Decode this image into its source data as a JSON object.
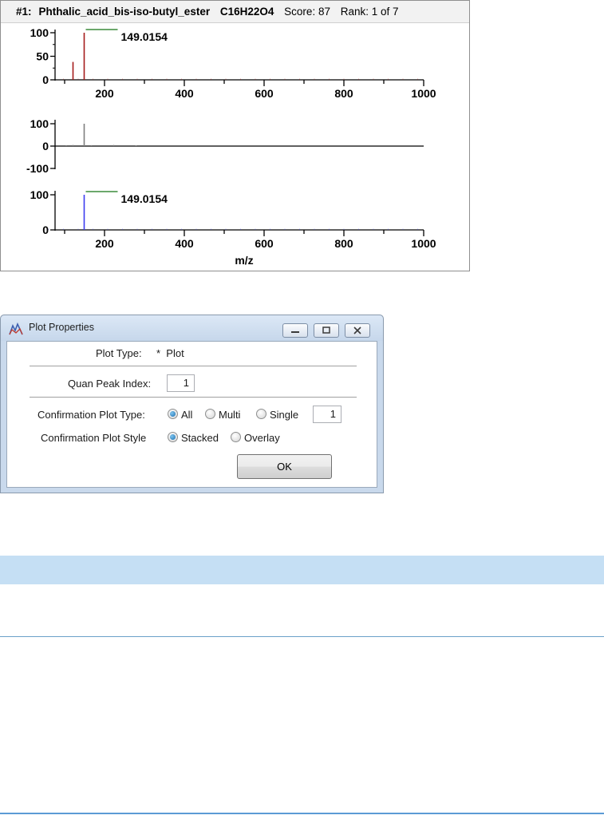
{
  "spectrum": {
    "header": {
      "hit_id": "#1:",
      "compound": "Phthalic_acid_bis-iso-butyl_ester",
      "formula": "C16H22O4",
      "score": "Score: 87",
      "rank": "Rank: 1 of 7"
    },
    "peak_label_top": "149.0154",
    "peak_label_bottom": "149.0154",
    "x_axis_label": "m/z",
    "colors": {
      "top": "#a51c1c",
      "middle": "#7f7f7f",
      "bottom": "#3d3df0",
      "marker": "#3c8c3c"
    }
  },
  "chart_data": [
    {
      "type": "bar",
      "xlim": [
        50,
        1000
      ],
      "ylim": [
        0,
        100
      ],
      "x_ticks": [
        "200",
        "400",
        "600",
        "800",
        "1000"
      ],
      "y_ticks": [
        "0",
        "50",
        "100"
      ],
      "series": [
        {
          "x": [
            121,
            149
          ],
          "values": [
            38,
            100
          ]
        }
      ],
      "annotations": [
        "149.0154"
      ]
    },
    {
      "type": "bar",
      "xlim": [
        50,
        1000
      ],
      "ylim": [
        -100,
        100
      ],
      "y_ticks": [
        "-100",
        "0",
        "100"
      ],
      "series": [
        {
          "x": [
            104,
            121,
            149,
            167,
            223,
            279
          ],
          "values": [
            4,
            5,
            100,
            4,
            5,
            3
          ]
        }
      ]
    },
    {
      "type": "bar",
      "xlim": [
        50,
        1000
      ],
      "ylim": [
        0,
        100
      ],
      "x_ticks": [
        "200",
        "400",
        "600",
        "800",
        "1000"
      ],
      "y_ticks": [
        "0",
        "100"
      ],
      "xlabel": "m/z",
      "series": [
        {
          "x": [
            149
          ],
          "values": [
            100
          ]
        }
      ],
      "annotations": [
        "149.0154"
      ]
    }
  ],
  "dialog": {
    "title": "Plot Properties",
    "plot_type_label": "Plot Type:",
    "plot_type_value": "*  Plot",
    "quan_peak_index_label": "Quan Peak Index:",
    "quan_peak_index_value": "1",
    "confirmation_plot_type_label": "Confirmation Plot Type:",
    "type_options": [
      "All",
      "Multi",
      "Single"
    ],
    "selected_type": "All",
    "single_value": "1",
    "confirmation_plot_style_label": "Confirmation Plot Style",
    "style_options": [
      "Stacked",
      "Overlay"
    ],
    "selected_style": "Stacked",
    "ok_label": "OK",
    "icons": [
      "plot-icon",
      "minimize-icon",
      "maximize-icon",
      "close-icon"
    ]
  }
}
